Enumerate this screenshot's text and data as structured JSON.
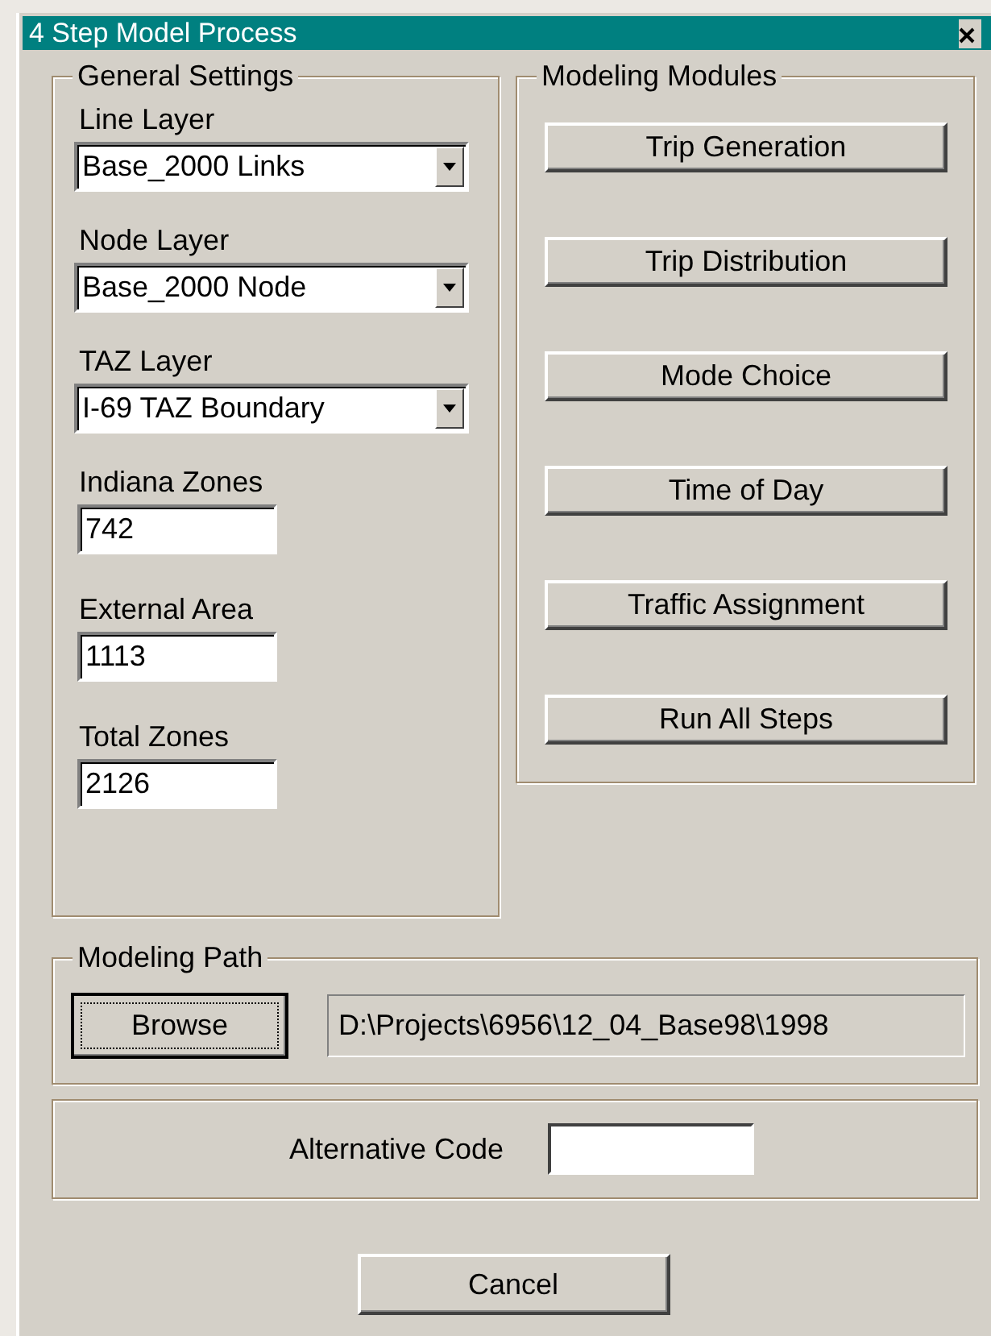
{
  "window": {
    "title": "4 Step Model Process"
  },
  "general_settings": {
    "title": "General Settings",
    "dropdowns": [
      {
        "label": "Line Layer",
        "value": "Base_2000 Links"
      },
      {
        "label": "Node Layer",
        "value": "Base_2000 Node"
      },
      {
        "label": "TAZ Layer",
        "value": "I-69 TAZ Boundary"
      }
    ],
    "fields": [
      {
        "label": "Indiana Zones",
        "value": "742"
      },
      {
        "label": "External Area",
        "value": "1113"
      },
      {
        "label": "Total Zones",
        "value": "2126"
      }
    ]
  },
  "modeling_modules": {
    "title": "Modeling Modules",
    "buttons": [
      "Trip Generation",
      "Trip Distribution",
      "Mode Choice",
      "Time of Day",
      "Traffic Assignment",
      "Run All Steps"
    ]
  },
  "modeling_path": {
    "title": "Modeling Path",
    "browse": {
      "label": "Browse",
      "focused": true
    },
    "path": "D:\\Projects\\6956\\12_04_Base98\\1998"
  },
  "alternative_code": {
    "label": "Alternative Code"
  },
  "footer_buttons": [
    "Cancel"
  ]
}
